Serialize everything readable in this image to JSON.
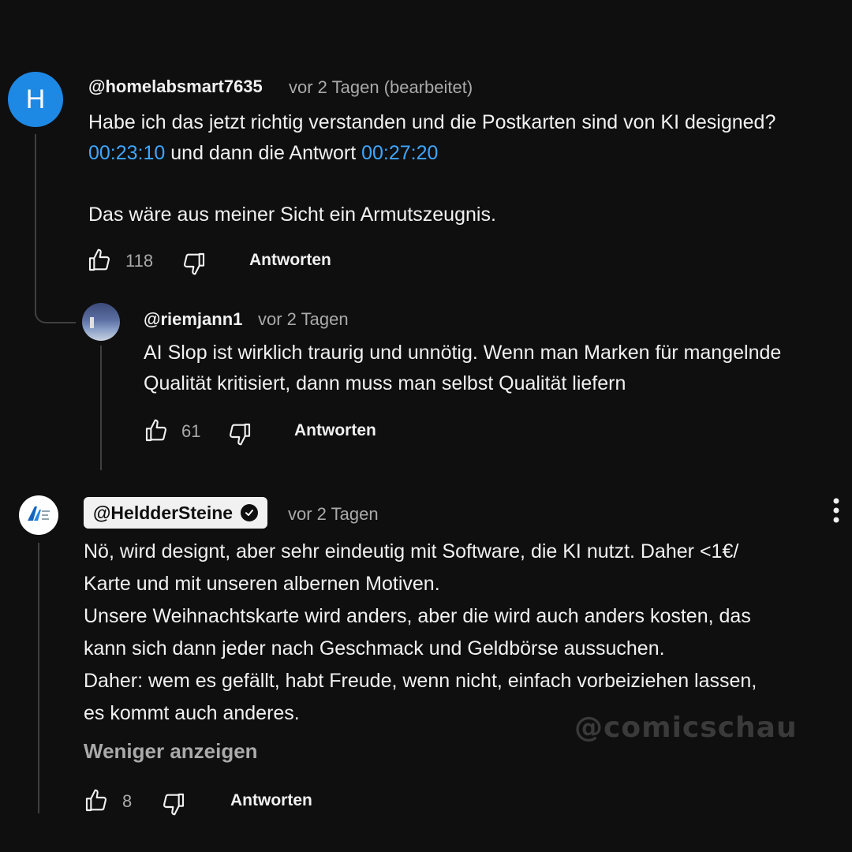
{
  "comment1": {
    "avatar_letter": "H",
    "avatar_color": "#1e88e5",
    "handle": "@homelabsmart7635",
    "time": "vor 2 Tagen (bearbeitet)",
    "line1": "Habe ich das jetzt richtig verstanden und die Postkarten sind von KI designed?",
    "ts1": "00:23:10",
    "line2_mid": " und dann die Antwort ",
    "ts2": "00:27:20",
    "line3": "Das wäre aus meiner Sicht ein Armutszeugnis.",
    "likes": "118",
    "reply_label": "Antworten"
  },
  "reply1": {
    "handle": "@riemjann1",
    "time": "vor 2 Tagen",
    "line1": "AI Slop ist wirklich traurig und unnötig. Wenn man Marken für mangelnde",
    "line2": "Qualität kritisiert, dann muss man selbst Qualität liefern",
    "likes": "61",
    "reply_label": "Antworten"
  },
  "comment2": {
    "handle": "@HeldderSteine",
    "time": "vor 2 Tagen",
    "lines": [
      "Nö, wird designt, aber sehr eindeutig mit Software, die KI nutzt. Daher <1€/",
      "Karte und mit unseren albernen Motiven.",
      "Unsere Weihnachtskarte wird anders, aber die wird auch anders kosten, das",
      "kann sich dann jeder nach Geschmack und Geldbörse aussuchen.",
      "Daher: wem es gefällt, habt Freude, wenn nicht, einfach vorbeiziehen lassen,",
      "es kommt auch anderes."
    ],
    "show_less": "Weniger anzeigen",
    "likes": "8",
    "reply_label": "Antworten"
  },
  "watermark": "@comicschau",
  "colors": {
    "timestamp_link": "#3ea6ff",
    "background": "#0f0f0f",
    "secondary_text": "#aaaaaa"
  },
  "icons": [
    "thumbs-up-icon",
    "thumbs-down-icon",
    "verified-check-icon",
    "more-vert-icon"
  ]
}
